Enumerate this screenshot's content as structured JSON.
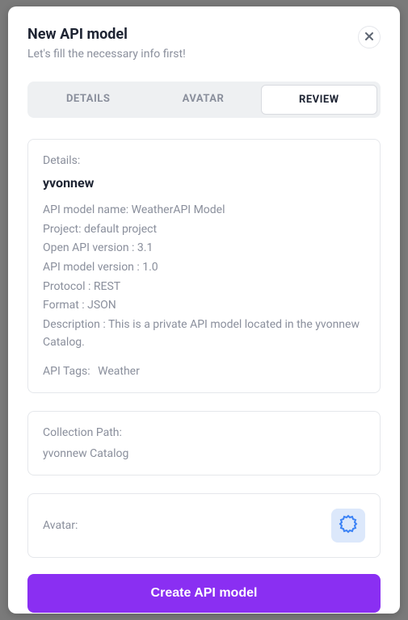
{
  "modal": {
    "title": "New API model",
    "subtitle": "Let's fill the necessary info first!"
  },
  "tabs": {
    "details": "DETAILS",
    "avatar": "AVATAR",
    "review": "REVIEW"
  },
  "details": {
    "label": "Details:",
    "owner": "yvonnew",
    "model_name_line": "API model name: WeatherAPI Model",
    "project_line": "Project: default project",
    "openapi_line": "Open API version : 3.1",
    "model_version_line": "API model version : 1.0",
    "protocol_line": "Protocol : REST",
    "format_line": "Format : JSON",
    "description_line": "Description : This is a private API model located in the yvonnew Catalog.",
    "tags_label": "API Tags:",
    "tags_value": "Weather"
  },
  "collection": {
    "label": "Collection Path:",
    "value": "yvonnew Catalog"
  },
  "avatar": {
    "label": "Avatar:"
  },
  "actions": {
    "create": "Create API model"
  }
}
